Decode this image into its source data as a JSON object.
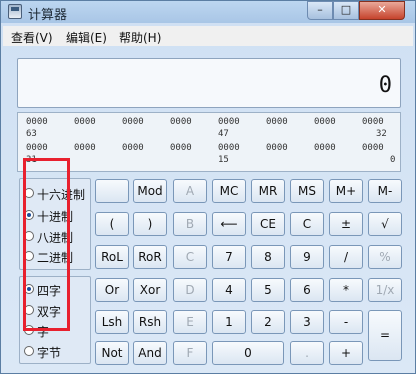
{
  "window": {
    "title": "计算器",
    "min": "–",
    "max": "□",
    "close": "✕"
  },
  "menu": [
    {
      "label": "查看(V)"
    },
    {
      "label": "编辑(E)"
    },
    {
      "label": "帮助(H)"
    }
  ],
  "display": {
    "value": "0"
  },
  "bits": {
    "row1": [
      "0000",
      "0000",
      "0000",
      "0000",
      "0000",
      "0000",
      "0000",
      "0000"
    ],
    "row1_positions": [
      "63",
      "47",
      "32"
    ],
    "row2": [
      "0000",
      "0000",
      "0000",
      "0000",
      "0000",
      "0000",
      "0000",
      "0000"
    ],
    "row2_positions": [
      "31",
      "15",
      "0"
    ]
  },
  "base": [
    {
      "label": "十六进制",
      "checked": false
    },
    {
      "label": "十进制",
      "checked": true
    },
    {
      "label": "八进制",
      "checked": false
    },
    {
      "label": "二进制",
      "checked": false
    }
  ],
  "word": [
    {
      "label": "四字",
      "checked": true
    },
    {
      "label": "双字",
      "checked": false
    },
    {
      "label": "字",
      "checked": false
    },
    {
      "label": "字节",
      "checked": false
    }
  ],
  "buttons": {
    "blank": "",
    "mod": "Mod",
    "a": "A",
    "mc": "MC",
    "mr": "MR",
    "ms": "MS",
    "mplus": "M+",
    "mminus": "M-",
    "lparen": "(",
    "rparen": ")",
    "b": "B",
    "back": "⟵",
    "ce": "CE",
    "c": "C",
    "pm": "±",
    "sqrt": "√",
    "rol": "RoL",
    "ror": "RoR",
    "cc": "C",
    "n7": "7",
    "n8": "8",
    "n9": "9",
    "div": "/",
    "pct": "%",
    "or": "Or",
    "xor": "Xor",
    "d": "D",
    "n4": "4",
    "n5": "5",
    "n6": "6",
    "mul": "*",
    "inv": "1/x",
    "lsh": "Lsh",
    "rsh": "Rsh",
    "e": "E",
    "n1": "1",
    "n2": "2",
    "n3": "3",
    "sub": "-",
    "eq": "=",
    "not": "Not",
    "and": "And",
    "f": "F",
    "n0": "0",
    "dot": ".",
    "add": "+"
  }
}
